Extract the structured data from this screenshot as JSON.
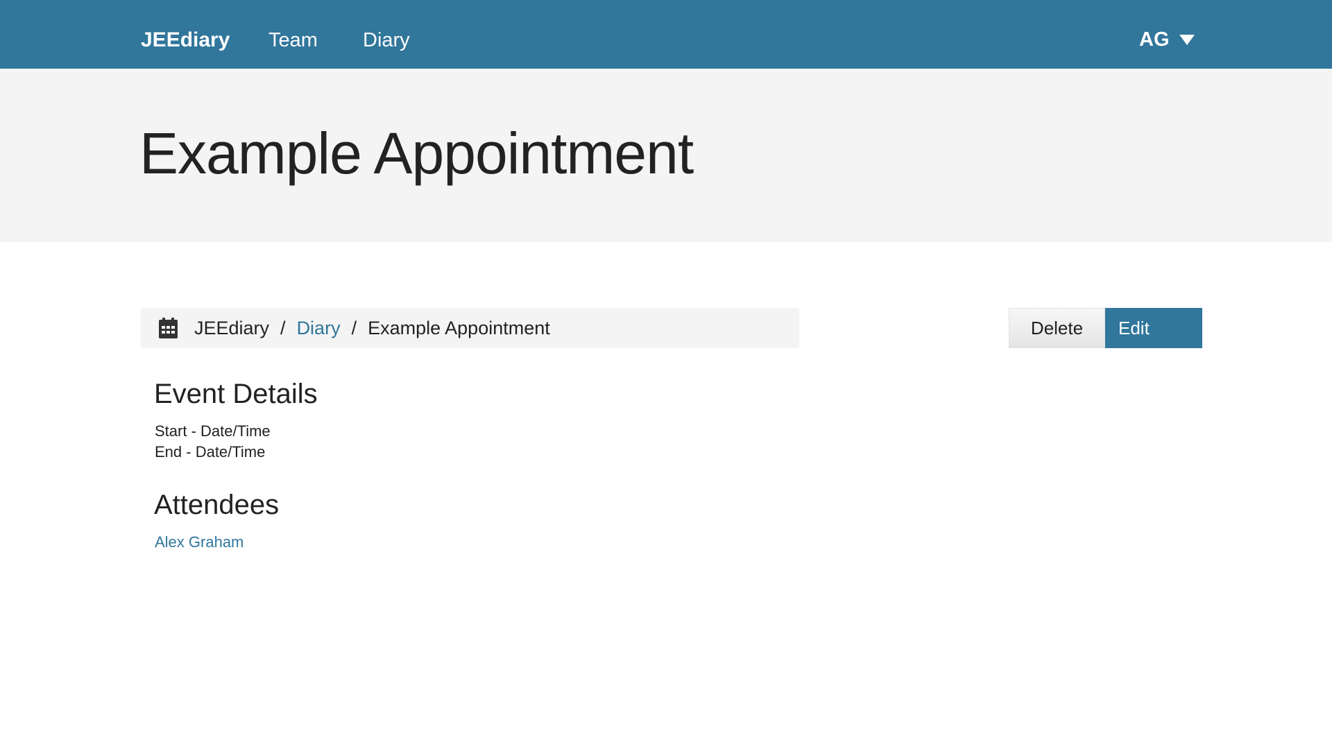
{
  "navbar": {
    "brand": "JEEdiary",
    "links": [
      {
        "label": "Team"
      },
      {
        "label": "Diary"
      }
    ],
    "user_initials": "AG",
    "background_color": "#31769b"
  },
  "header": {
    "title": "Example Appointment"
  },
  "breadcrumb": {
    "icon": "calendar-icon",
    "items": [
      {
        "label": "JEEdiary",
        "link": false
      },
      {
        "label": "Diary",
        "link": true
      },
      {
        "label": "Example Appointment",
        "link": false
      }
    ],
    "separator": "/"
  },
  "actions": {
    "delete_label": "Delete",
    "edit_label": "Edit"
  },
  "event_details": {
    "heading": "Event Details",
    "start": "Start - Date/Time",
    "end": "End - Date/Time"
  },
  "attendees": {
    "heading": "Attendees",
    "list": [
      {
        "name": "Alex Graham"
      }
    ]
  },
  "colors": {
    "accent": "#31769b",
    "header_bg": "#f4f4f4",
    "text": "#222222"
  }
}
